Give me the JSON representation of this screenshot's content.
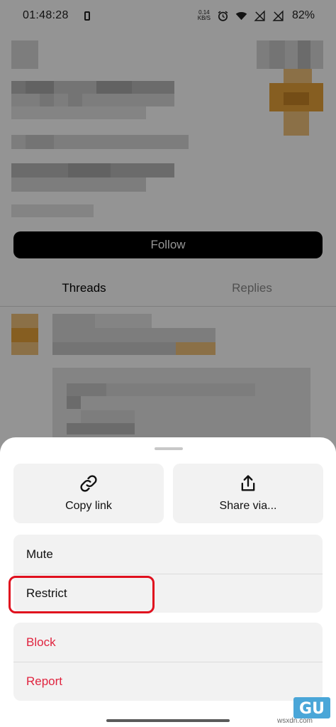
{
  "status_bar": {
    "time": "01:48:28",
    "net_speed_value": "0.14",
    "net_speed_unit": "KB/S",
    "battery_percent": "82%"
  },
  "profile": {
    "follow_label": "Follow",
    "tabs": [
      {
        "label": "Threads",
        "active": true
      },
      {
        "label": "Replies",
        "active": false
      }
    ]
  },
  "sheet": {
    "actions": [
      {
        "label": "Copy link",
        "icon": "link-icon"
      },
      {
        "label": "Share via...",
        "icon": "share-icon"
      }
    ],
    "group1": [
      {
        "label": "Mute"
      },
      {
        "label": "Restrict",
        "highlighted": true
      }
    ],
    "group2": [
      {
        "label": "Block"
      },
      {
        "label": "Report"
      }
    ],
    "danger_color": "#e0243f",
    "highlight_color": "#e0101e"
  },
  "watermark": {
    "logo_text": "GU",
    "domain": "wsxdn.com"
  }
}
